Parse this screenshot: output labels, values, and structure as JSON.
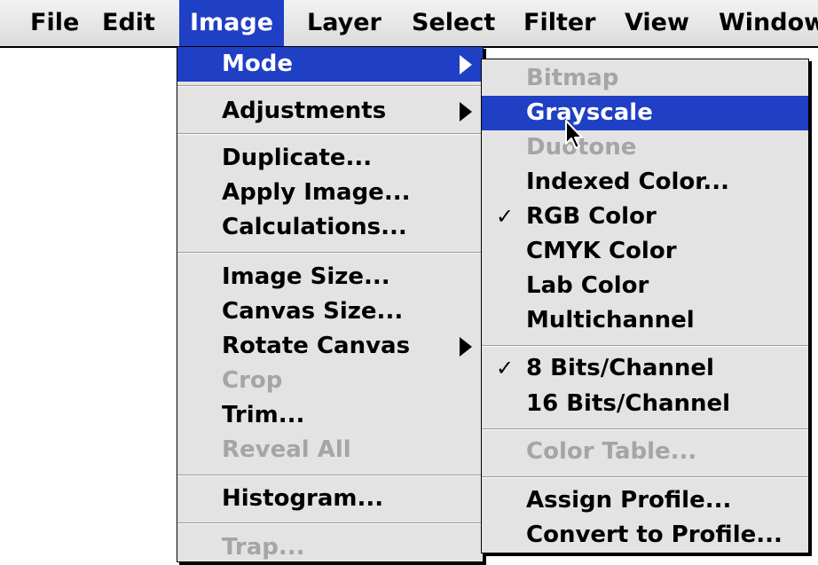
{
  "menubar": {
    "items": [
      "File",
      "Edit",
      "Image",
      "Layer",
      "Select",
      "Filter",
      "View",
      "Window"
    ]
  },
  "image_menu": {
    "items": [
      {
        "label": "Mode",
        "state": "selected",
        "submenu": true
      },
      {
        "label": "Adjustments",
        "submenu": true
      },
      {
        "label": "Duplicate..."
      },
      {
        "label": "Apply Image..."
      },
      {
        "label": "Calculations..."
      },
      {
        "label": "Image Size..."
      },
      {
        "label": "Canvas Size..."
      },
      {
        "label": "Rotate Canvas",
        "submenu": true
      },
      {
        "label": "Crop",
        "state": "disabled"
      },
      {
        "label": "Trim..."
      },
      {
        "label": "Reveal All",
        "state": "disabled"
      },
      {
        "label": "Histogram..."
      },
      {
        "label": "Trap...",
        "state": "disabled"
      }
    ]
  },
  "mode_menu": {
    "items": [
      {
        "label": "Bitmap",
        "state": "disabled"
      },
      {
        "label": "Grayscale",
        "state": "selected"
      },
      {
        "label": "Duotone",
        "state": "disabled"
      },
      {
        "label": "Indexed Color..."
      },
      {
        "label": "RGB Color",
        "checked": true
      },
      {
        "label": "CMYK Color"
      },
      {
        "label": "Lab Color"
      },
      {
        "label": "Multichannel"
      },
      {
        "label": "8 Bits/Channel",
        "checked": true
      },
      {
        "label": "16 Bits/Channel"
      },
      {
        "label": "Color Table...",
        "state": "disabled"
      },
      {
        "label": "Assign Profile..."
      },
      {
        "label": "Convert to Profile..."
      }
    ]
  },
  "check_glyph": "✓",
  "colors": {
    "highlight": "#1f3fc4",
    "menu_bg": "#e3e3e3",
    "disabled": "#a5a5a5"
  }
}
